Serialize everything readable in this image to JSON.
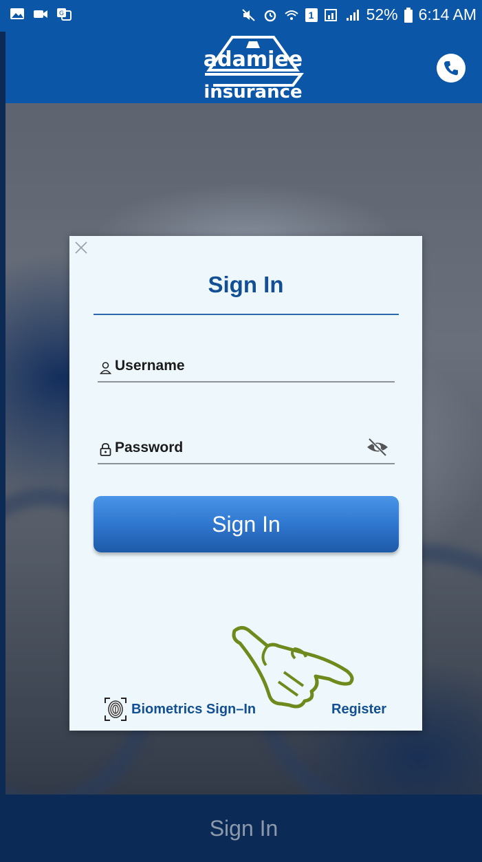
{
  "status_bar": {
    "battery": "52%",
    "time": "6:14 AM",
    "sim_slot": "1",
    "icons": [
      "gallery-icon",
      "video-icon",
      "translate-icon",
      "mute-icon",
      "alarm-icon",
      "wifi-icon",
      "sim-icon",
      "signal-icon",
      "battery-icon"
    ]
  },
  "app_bar": {
    "logo_text_top": "adamjee",
    "logo_text_bottom": "insurance",
    "call_icon": "phone-icon"
  },
  "modal": {
    "title": "Sign In",
    "username_placeholder": "Username",
    "password_placeholder": "Password",
    "signin_label": "Sign In",
    "biometrics_label": "Biometrics Sign–In",
    "register_label": "Register"
  },
  "bottom": {
    "signin_label": "Sign In"
  },
  "colors": {
    "brand_blue": "#0b56a6",
    "title_blue": "#134f93",
    "modal_bg": "#eef8fc",
    "bottom_bar": "#0b2b56",
    "hand_green": "#6f8a1c"
  }
}
